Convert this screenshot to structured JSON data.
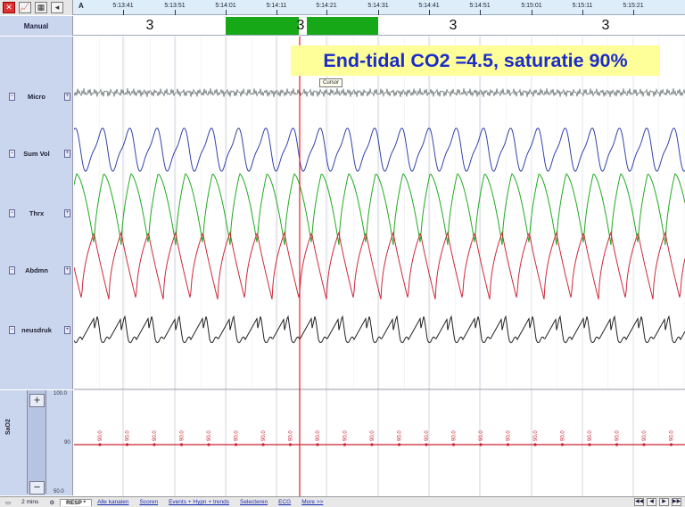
{
  "toolbar": {
    "icons": [
      "close-icon",
      "chart-icon",
      "calendar-icon",
      "speaker-icon"
    ]
  },
  "ruler": {
    "letter": "A",
    "times": [
      "5:13:41",
      "5:13:51",
      "5:14:01",
      "5:14:11",
      "5:14:21",
      "5:14:31",
      "5:14:41",
      "5:14:51",
      "5:15:01",
      "5:15:11",
      "5:15:21"
    ]
  },
  "manual": {
    "label": "Manual",
    "scores": [
      "3",
      "3",
      "3",
      "3"
    ]
  },
  "channels": [
    {
      "label": "Micro",
      "color": "#707878"
    },
    {
      "label": "Sum Vol",
      "color": "#3344aa"
    },
    {
      "label": "Thrx",
      "color": "#22aa22"
    },
    {
      "label": "Abdmn",
      "color": "#cc2a3a"
    },
    {
      "label": "neusdruk",
      "color": "#222222"
    }
  ],
  "annotation": {
    "banner": "End-tidal CO2 =4.5, saturatie 90%",
    "cursor_tooltip": "Cursor"
  },
  "sao2": {
    "label": "SaO2",
    "scale_top": "100.0",
    "scale_mid": "90",
    "scale_bottom": "50.0",
    "value_label": "90.0",
    "color": "#cc2233"
  },
  "bottom_bar": {
    "window": "2 mins",
    "tabs": [
      "RESP *",
      "Alle kanalen",
      "Scoren",
      "Events + Hypn + trends",
      "Selecteren",
      "ECG",
      "More >>"
    ]
  },
  "colors": {
    "panel": "#c9d6ee",
    "cursor": "#dd2222",
    "score_block": "#17a817"
  }
}
